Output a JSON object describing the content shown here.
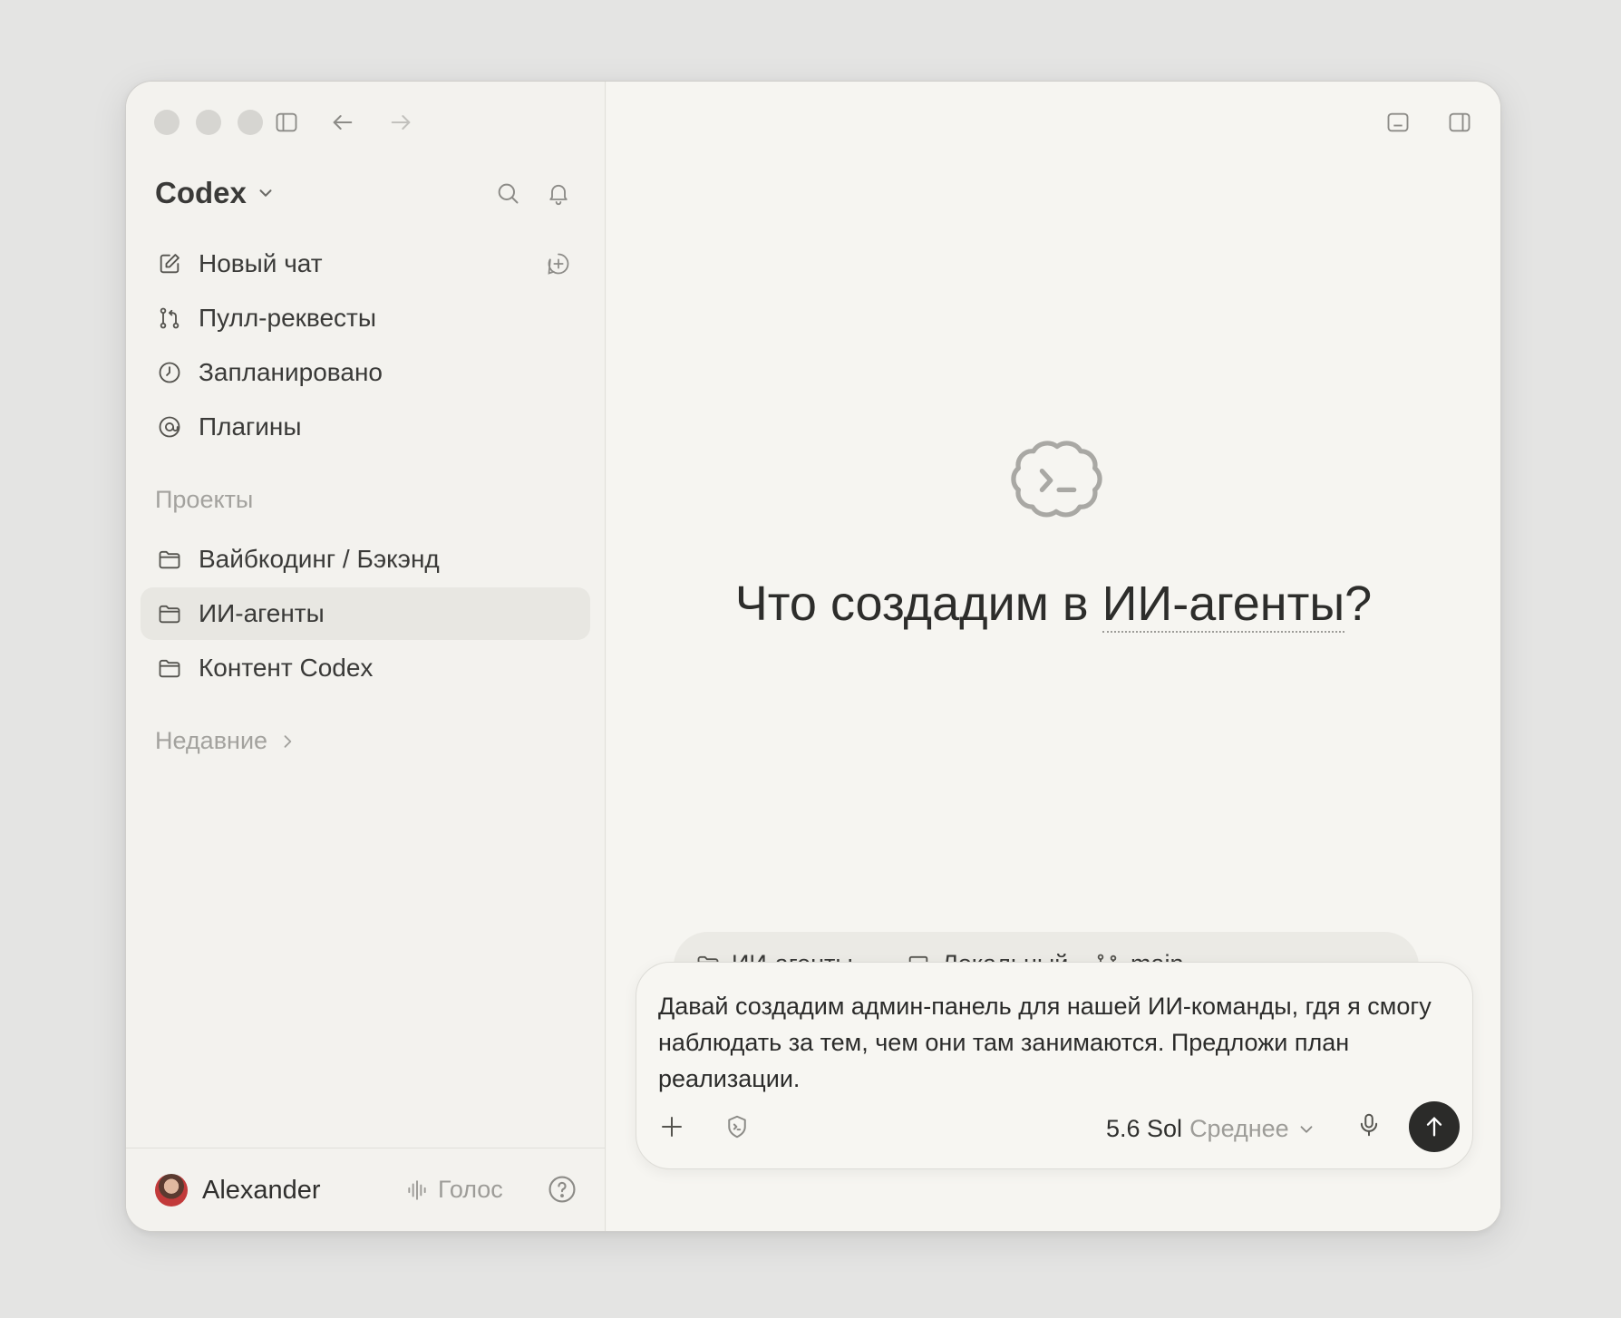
{
  "app": {
    "title": "Codex"
  },
  "sidebar": {
    "nav": [
      {
        "label": "Новый чат",
        "icon": "edit-icon"
      },
      {
        "label": "Пулл-реквесты",
        "icon": "pull-request-icon"
      },
      {
        "label": "Запланировано",
        "icon": "clock-icon"
      },
      {
        "label": "Плагины",
        "icon": "plugin-icon"
      }
    ],
    "projects_label": "Проекты",
    "projects": [
      {
        "label": "Вайбкодинг / Бэкэнд",
        "active": false
      },
      {
        "label": "ИИ-агенты",
        "active": true
      },
      {
        "label": "Контент Codex",
        "active": false
      }
    ],
    "recent_label": "Недавние"
  },
  "footer": {
    "user_name": "Alexander",
    "voice_label": "Голос"
  },
  "main": {
    "hero": {
      "prefix": "Что создадим в ",
      "project": "ИИ-агенты",
      "suffix": "?"
    },
    "context": {
      "project": "ИИ-агенты",
      "environment": "Локальный",
      "branch": "main"
    },
    "composer": {
      "text": "Давай создадим админ-панель для нашей ИИ-команды, гдя я смогу наблюдать за тем, чем они там занимаются. Предложи план реализации.",
      "model": "5.6 Sol",
      "effort": "Среднее"
    }
  },
  "colors": {
    "background": "#e4e4e3",
    "window": "#f5f4f0",
    "send_button": "#2b2b29",
    "active_item": "#e8e7e2"
  }
}
